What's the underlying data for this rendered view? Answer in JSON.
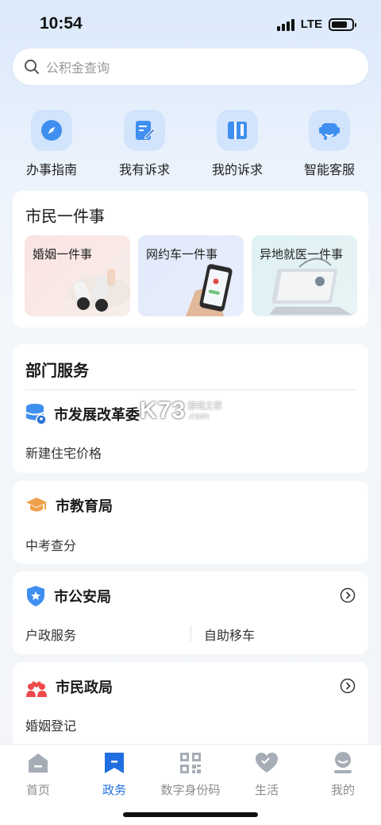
{
  "status_bar": {
    "time": "10:54",
    "network": "LTE"
  },
  "search": {
    "placeholder": "公积金查询"
  },
  "quick_actions": [
    {
      "label": "办事指南",
      "icon": "compass-icon"
    },
    {
      "label": "我有诉求",
      "icon": "edit-form-icon"
    },
    {
      "label": "我的诉求",
      "icon": "book-pen-icon"
    },
    {
      "label": "智能客服",
      "icon": "headset-icon"
    }
  ],
  "citizen_events": {
    "title": "市民一件事",
    "items": [
      {
        "label": "婚姻一件事"
      },
      {
        "label": "网约车一件事"
      },
      {
        "label": "异地就医一件事"
      }
    ]
  },
  "dept_services": {
    "title": "部门服务",
    "departments": [
      {
        "name": "市发展改革委",
        "icon": "database-icon",
        "items": [
          "新建住宅价格"
        ]
      },
      {
        "name": "市教育局",
        "icon": "graduation-cap-icon",
        "items": [
          "中考查分"
        ]
      },
      {
        "name": "市公安局",
        "icon": "police-badge-icon",
        "items": [
          "户政服务",
          "自助移车"
        ]
      },
      {
        "name": "市民政局",
        "icon": "couple-heart-icon",
        "items": [
          "婚姻登记"
        ]
      }
    ]
  },
  "watermark": {
    "brand": "K73",
    "line1": "游戏之家",
    "line2": ".com"
  },
  "tabbar": {
    "active": "政务",
    "tabs": [
      {
        "label": "首页",
        "icon": "home-icon"
      },
      {
        "label": "政务",
        "icon": "bookmark-icon"
      },
      {
        "label": "数字身份码",
        "icon": "qr-code-icon"
      },
      {
        "label": "生活",
        "icon": "heart-icon"
      },
      {
        "label": "我的",
        "icon": "profile-icon"
      }
    ]
  },
  "colors": {
    "accent": "#1f6fe0",
    "icon_blue": "#3f8ff0",
    "edu_orange": "#f0a04a",
    "civil_red": "#ee4b4b"
  }
}
